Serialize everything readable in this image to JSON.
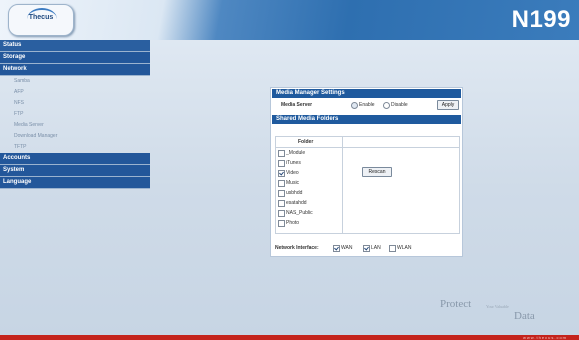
{
  "header": {
    "logo_text": "Thecus",
    "model": "N199"
  },
  "sidebar": {
    "categories": [
      {
        "label": "Status"
      },
      {
        "label": "Storage"
      },
      {
        "label": "Network"
      },
      {
        "label": "Accounts"
      },
      {
        "label": "System"
      },
      {
        "label": "Language"
      }
    ],
    "network_items": [
      "Samba",
      "AFP",
      "NFS",
      "FTP",
      "Media Server",
      "Download Manager",
      "TFTP"
    ]
  },
  "panel": {
    "media_title": "Media Manager Settings",
    "media_server_label": "Media Server",
    "enable_label": "Enable",
    "disable_label": "Disable",
    "apply_label": "Apply",
    "shared_title": "Shared Media Folders",
    "folder_header": "Folder",
    "folders": [
      {
        "name": "_Module",
        "checked": false
      },
      {
        "name": "iTunes",
        "checked": false
      },
      {
        "name": "Video",
        "checked": true
      },
      {
        "name": "Music",
        "checked": false
      },
      {
        "name": "usbhdd",
        "checked": false
      },
      {
        "name": "esatahdd",
        "checked": false
      },
      {
        "name": "NAS_Public",
        "checked": false
      },
      {
        "name": "Photo",
        "checked": false
      }
    ],
    "rescan_label": "Rescan",
    "network_interface_label": "Network Interface:",
    "wan_label": "WAN",
    "lan_label": "LAN",
    "wlan_label": "WLAN"
  },
  "footer": {
    "protect": "Protect",
    "your_valuable": "Your Valuable",
    "data": "Data",
    "url": "www.thecus.com"
  },
  "colors": {
    "header_blue": "#2e6fb0",
    "nav_blue": "#23579a",
    "footer_red": "#c4231c"
  }
}
